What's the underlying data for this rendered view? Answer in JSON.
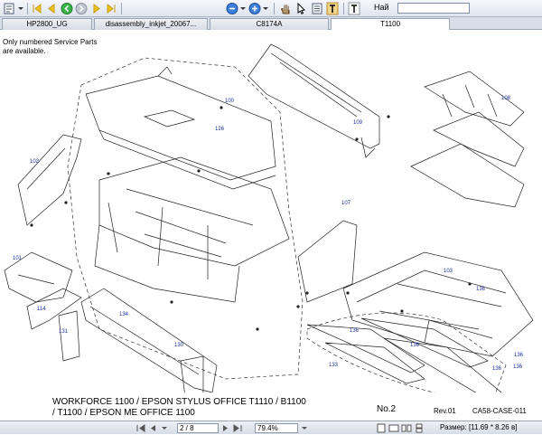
{
  "toolbar": {
    "icons": [
      "page-tool-icon",
      "open-menu-icon",
      "first-page-icon",
      "prev-page-icon",
      "back-icon",
      "forward-icon",
      "next-page-icon",
      "last-page-icon",
      "zoom-out-icon",
      "zoom-menu-icon",
      "zoom-in-icon",
      "zoom-in-menu-icon",
      "hand-tool-icon",
      "select-tool-icon",
      "text-select-icon",
      "text-tool-icon"
    ],
    "find_label": "Най",
    "find_value": ""
  },
  "tabs": [
    {
      "label": "HP2800_UG",
      "active": false
    },
    {
      "label": "disassembly_inkjet_20067...",
      "active": false
    },
    {
      "label": "C8174A",
      "active": false
    },
    {
      "label": "T1100",
      "active": true
    }
  ],
  "document": {
    "note": [
      "Only numbered Service Parts",
      "are available."
    ],
    "title_lines": [
      "WORKFORCE 1100 / EPSON STYLUS OFFICE T1110 / B1100",
      "/ T1100 / EPSON ME OFFICE 1100"
    ],
    "page_no": "No.2",
    "revision": "Rev.01",
    "doc_id": "CA58-CASE-011",
    "part_labels": [
      {
        "text": "100"
      },
      {
        "text": "126"
      },
      {
        "text": "109"
      },
      {
        "text": "108"
      },
      {
        "text": "102"
      },
      {
        "text": "107"
      },
      {
        "text": "101"
      },
      {
        "text": "103"
      },
      {
        "text": "136"
      },
      {
        "text": "136"
      },
      {
        "text": "136"
      },
      {
        "text": "136"
      },
      {
        "text": "136"
      },
      {
        "text": "136"
      },
      {
        "text": "114"
      },
      {
        "text": "134"
      },
      {
        "text": "131"
      },
      {
        "text": "130"
      },
      {
        "text": "133"
      }
    ]
  },
  "statusbar": {
    "page_value": "2 / 8",
    "zoom_value": "79.4%",
    "size_label": "Размер: [11.69 * 8.26 в]"
  }
}
